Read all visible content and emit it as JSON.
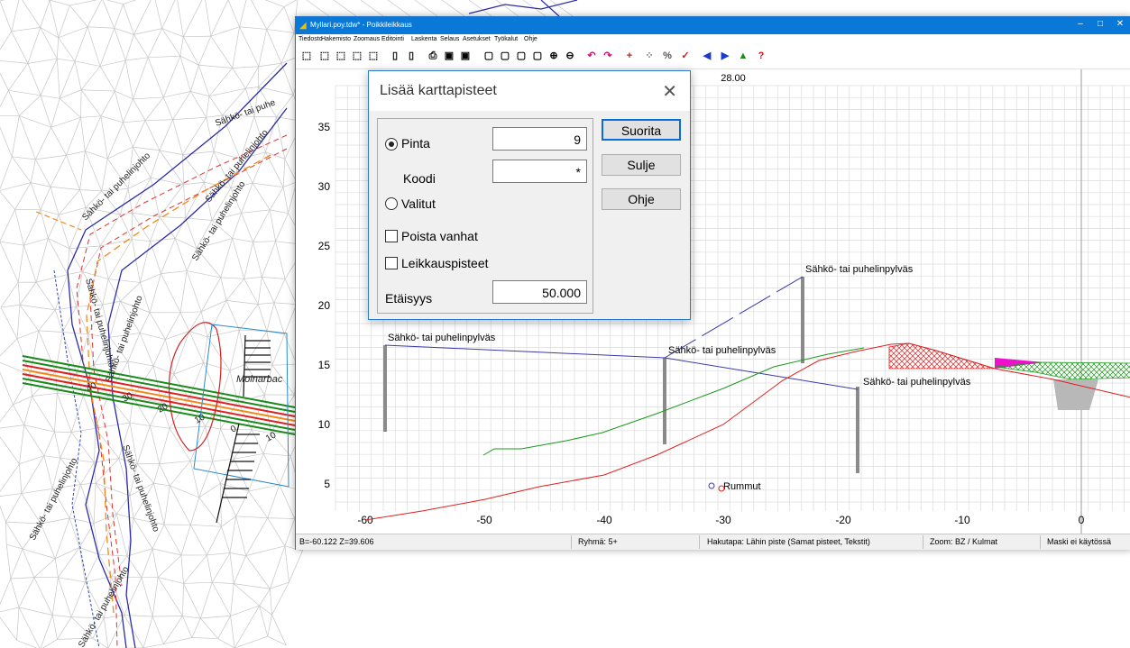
{
  "window": {
    "title": "Myllari.poy.tdw* - Poikkileikkaus",
    "min_glyph": "–",
    "max_glyph": "□",
    "close_glyph": "✕"
  },
  "menu": [
    "Tiedosto",
    "Hakemisto",
    "Zoomaus",
    "Editointi",
    "Laskenta",
    "Selaus",
    "Asetukset",
    "Työkalut",
    "Ohje"
  ],
  "plot": {
    "header_value": "28.00",
    "y_ticks": [
      "35",
      "30",
      "25",
      "20",
      "15",
      "10",
      "5"
    ],
    "x_ticks": [
      "-60",
      "-50",
      "-40",
      "-30",
      "-20",
      "-10",
      "0"
    ],
    "labels": {
      "pylvas": "Sähkö- tai puhelinpylväs",
      "rummut": "Rummut"
    }
  },
  "dialog": {
    "title": "Lisää karttapisteet",
    "close_glyph": "✕",
    "pinta_label": "Pinta",
    "pinta_value": "9",
    "koodi_label": "Koodi",
    "koodi_value": "*",
    "valitut_label": "Valitut",
    "poista_label": "Poista vanhat",
    "leikkaus_label": "Leikkauspisteet",
    "etaisyys_label": "Etäisyys",
    "etaisyys_value": "50.000",
    "buttons": {
      "suorita": "Suorita",
      "sulje": "Sulje",
      "ohje": "Ohje"
    },
    "selected_radio": "Pinta",
    "checked": {
      "poista": false,
      "leikkaus": false
    }
  },
  "status": {
    "coords": "B=-60.122  Z=39.606",
    "group": "Ryhmä: 5+",
    "search": "Hakutapa: Lähin piste (Samat pisteet, Tekstit)",
    "zoom": "Zoom: BZ  /  Kulmat",
    "mask": "Maski ei käytössä"
  },
  "map": {
    "labels": [
      "Sähkö- tai puhelinjohto",
      "Sähkö- tai puhelinjohto",
      "Sähkö- tai puhelinjohto",
      "Sähkö- tai puhelinjohto",
      "Sähkö- tai puhelinjohto",
      "Sähkö- tai puhelinjohto",
      "Sähkö- tai puhelinjohto",
      "Sähkö- tai puhelinjohto",
      "Sähkö- tai puhe"
    ],
    "place": "Molnarbac",
    "stations": [
      "40",
      "30",
      "20",
      "10",
      "0",
      "10"
    ]
  },
  "colors": {
    "titlebar": "#0a78d7",
    "green_line": "#1a9a1a",
    "red_line": "#e02020",
    "blue_line": "#2a2aa0"
  }
}
